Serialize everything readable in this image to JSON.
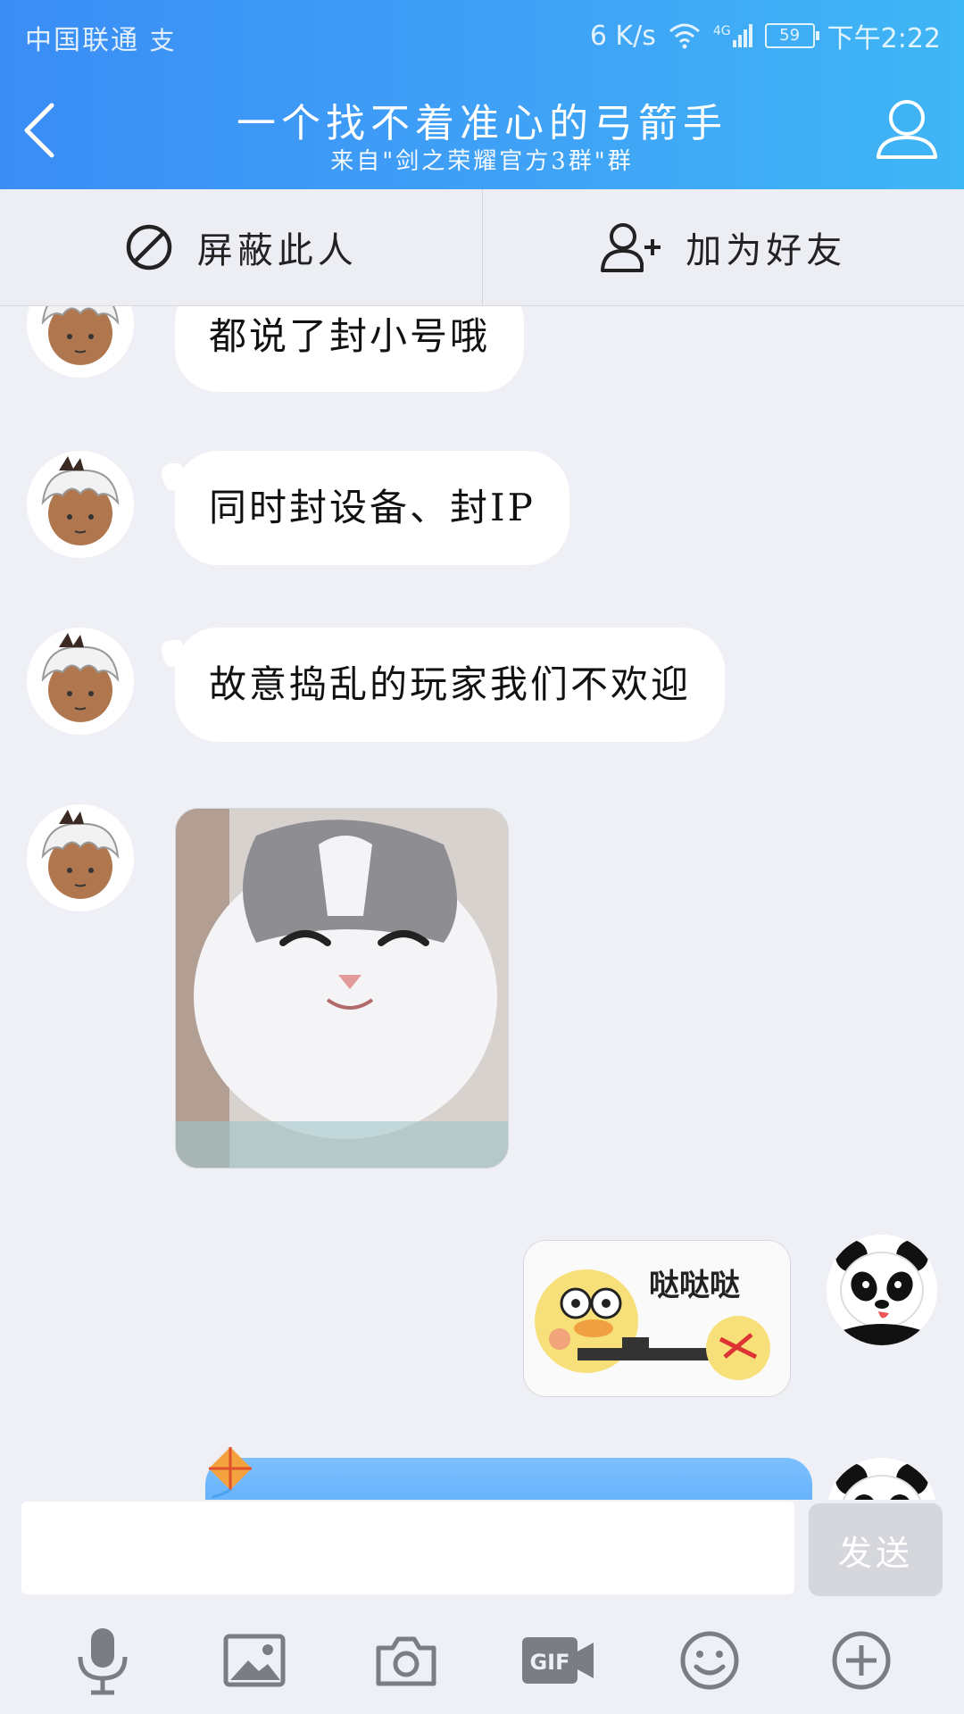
{
  "status_bar": {
    "carrier": "中国联通",
    "speed": "6 K/s",
    "network": "4G",
    "battery": "59",
    "time": "下午2:22"
  },
  "nav": {
    "title": "一个找不着准心的弓箭手",
    "subtitle": "来自\"剑之荣耀官方3群\"群"
  },
  "actions": {
    "block_label": "屏蔽此人",
    "add_friend_label": "加为好友"
  },
  "messages": [
    {
      "text": "都说了封小号哦"
    },
    {
      "text": "同时封设备、封IP"
    },
    {
      "text": "故意捣乱的玩家我们不欢迎"
    }
  ],
  "sticker": {
    "text": "哒哒哒"
  },
  "input": {
    "value": "",
    "send_label": "发送"
  },
  "icons": {
    "back": "chevron-left-icon",
    "profile": "person-icon",
    "block": "block-icon",
    "add_friend": "add-person-icon",
    "mic": "microphone-icon",
    "image": "image-icon",
    "camera": "camera-icon",
    "gif": "gif-icon",
    "emoji": "emoji-icon",
    "plus": "plus-circle-icon"
  },
  "colors": {
    "header": "#3a8df5",
    "bubble_blue": "#5aaaf7",
    "chat_bg": "#eef0f6"
  }
}
